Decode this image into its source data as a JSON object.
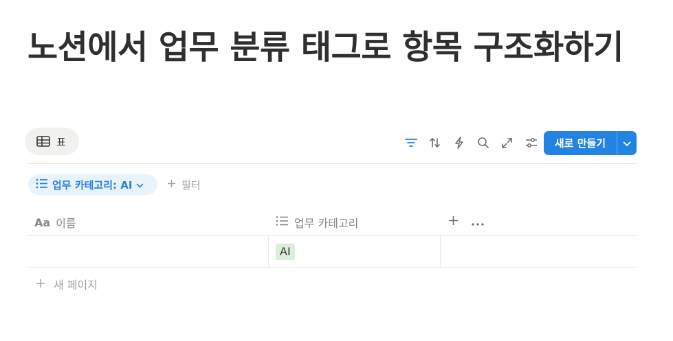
{
  "page": {
    "title": "노션에서 업무 분류 태그로 항목 구조화하기"
  },
  "view": {
    "tab_label": "표",
    "tab_icon": "table-icon"
  },
  "toolbar": {
    "icons": [
      "filter-icon",
      "sort-icon",
      "automation-icon",
      "search-icon",
      "expand-icon",
      "settings-icon"
    ],
    "new_button_label": "새로 만들기"
  },
  "filters": {
    "active_chip_label": "업무 카테고리: AI",
    "add_filter_label": "필터"
  },
  "table": {
    "columns": [
      {
        "label": "이름",
        "icon": "text-property-icon"
      },
      {
        "label": "업무 카테고리",
        "icon": "list-property-icon"
      }
    ],
    "rows": [
      {
        "name": "",
        "category": "AI"
      }
    ],
    "new_page_label": "새 페이지"
  },
  "colors": {
    "accent": "#2383e2",
    "filter_chip_bg": "#e9f3fc",
    "tag_bg": "#dbeddb"
  }
}
